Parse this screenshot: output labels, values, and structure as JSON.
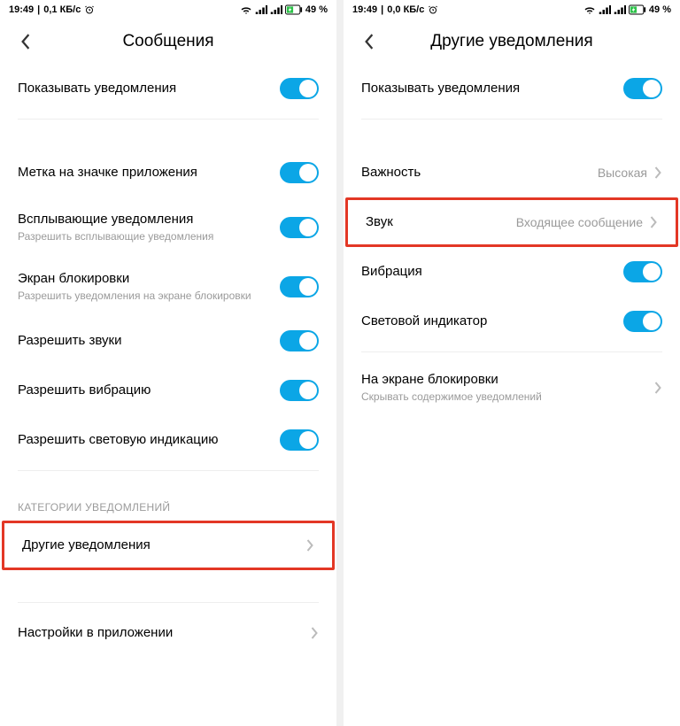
{
  "status": {
    "time": "19:49",
    "left_speed": "0,1 КБ/с",
    "right_speed": "0,0 КБ/с",
    "battery": "49 %"
  },
  "left": {
    "title": "Сообщения",
    "rows": {
      "show_notifs": "Показывать уведомления",
      "badge": "Метка на значке приложения",
      "popups_label": "Всплывающие уведомления",
      "popups_sub": "Разрешить всплывающие уведомления",
      "lock_label": "Экран блокировки",
      "lock_sub": "Разрешить уведомления на экране блокировки",
      "allow_sound": "Разрешить звуки",
      "allow_vibration": "Разрешить вибрацию",
      "allow_led": "Разрешить световую индикацию",
      "cat_header": "КАТЕГОРИИ УВЕДОМЛЕНИЙ",
      "other": "Другие уведомления",
      "app_settings": "Настройки в приложении"
    }
  },
  "right": {
    "title": "Другие уведомления",
    "rows": {
      "show_notifs": "Показывать уведомления",
      "importance_label": "Важность",
      "importance_value": "Высокая",
      "sound_label": "Звук",
      "sound_value": "Входящее сообщение",
      "vibration": "Вибрация",
      "led": "Световой индикатор",
      "lock_label": "На экране блокировки",
      "lock_sub": "Скрывать содержимое уведомлений"
    }
  }
}
